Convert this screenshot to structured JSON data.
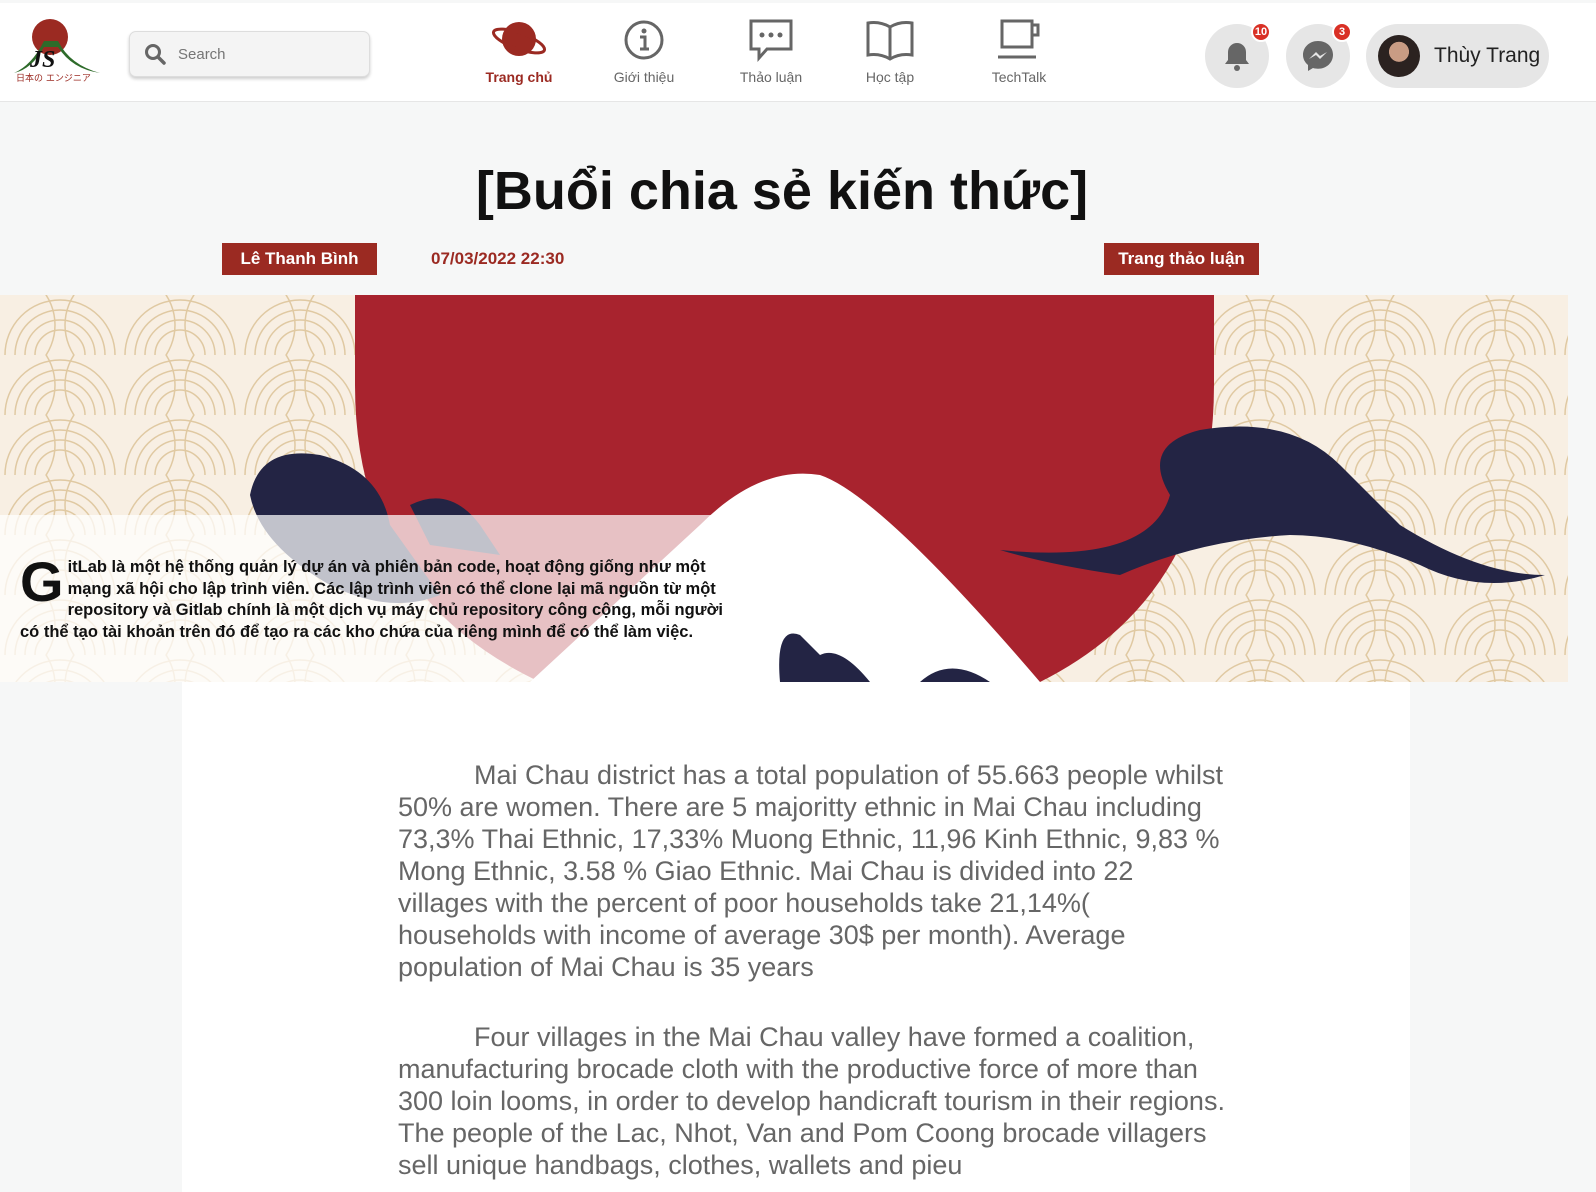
{
  "header": {
    "logo_text": "日本の エンジニア",
    "search": {
      "placeholder": "Search"
    },
    "nav": [
      {
        "label": "Trang chủ",
        "icon": "planet-icon",
        "active": true
      },
      {
        "label": "Giới thiệu",
        "icon": "info-icon"
      },
      {
        "label": "Thảo luận",
        "icon": "chat-icon"
      },
      {
        "label": "Học tập",
        "icon": "book-icon"
      },
      {
        "label": "TechTalk",
        "icon": "cup-icon"
      }
    ],
    "notifications": {
      "count": "10"
    },
    "messages": {
      "count": "3"
    },
    "user": {
      "name": "Thùy Trang"
    }
  },
  "post": {
    "title": "[Buổi chia sẻ kiến thức]",
    "author": "Lê Thanh Bình",
    "datetime": "07/03/2022 22:30",
    "category": "Trang thảo luận",
    "intro_dropcap": "G",
    "intro": "itLab là một hệ thống quản lý dự án và phiên bản code, hoạt động giống như một mạng xã hội cho lập trình viên. Các lập trình viên có thể clone lại mã nguồn từ một repository và Gitlab chính là một dịch vụ máy chủ repository công cộng, mỗi người có thể tạo tài khoản trên đó để tạo ra các kho chứa của riêng mình để có thể làm việc.",
    "paragraphs": [
      "Mai Chau district has a total population of 55.663 people whilst 50% are women. There are 5 majoritty ethnic in Mai Chau including 73,3% Thai Ethnic, 17,33% Muong Ethnic, 11,96 Kinh Ethnic, 9,83 % Mong Ethnic, 3.58 % Giao Ethnic. Mai Chau is divided into 22 villages with the percent of poor households take 21,14%( households with income of average 30$ per month). Average population of Mai Chau is 35 years",
      "Four villages in the Mai Chau valley have formed a coalition, manufacturing brocade cloth with the productive force of more than 300 loin looms, in order to develop handicraft tourism in their regions. The people of the Lac, Nhot, Van and Pom Coong brocade villagers sell unique handbags, clothes, wallets and pieu"
    ]
  },
  "colors": {
    "brand": "#9b2a22",
    "navy": "#232444",
    "cream": "#f8efe3"
  }
}
